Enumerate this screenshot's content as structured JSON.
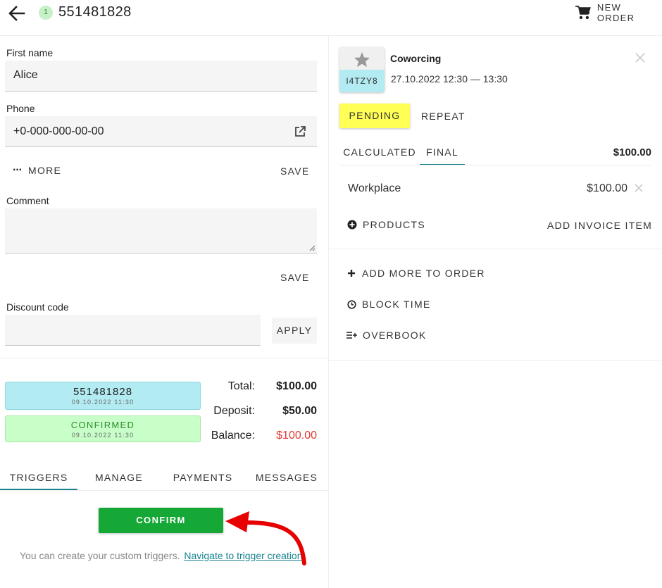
{
  "header": {
    "back_icon": "arrow-left-icon",
    "badge_count": "1",
    "order_id": "551481828",
    "new_order_label": "NEW ORDER",
    "cart_icon": "cart-icon"
  },
  "form": {
    "first_name_label": "First name",
    "first_name_value": "Alice",
    "phone_label": "Phone",
    "phone_value": "+0-000-000-00-00",
    "more_label": "MORE",
    "save_label": "SAVE",
    "comment_label": "Comment",
    "comment_value": "",
    "comment_save_label": "SAVE",
    "discount_label": "Discount code",
    "discount_value": "",
    "apply_label": "APPLY"
  },
  "status_cards": {
    "order_number": "551481828",
    "order_date": "09.10.2022 11:30",
    "confirmed_label": "CONFIRMED",
    "confirmed_date": "09.10.2022 11:30"
  },
  "totals": {
    "total_label": "Total:",
    "total_value": "$100.00",
    "deposit_label": "Deposit:",
    "deposit_value": "$50.00",
    "balance_label": "Balance:",
    "balance_value": "$100.00"
  },
  "tabs": [
    {
      "label": "TRIGGERS",
      "active": true
    },
    {
      "label": "MANAGE",
      "active": false
    },
    {
      "label": "PAYMENTS",
      "active": false
    },
    {
      "label": "MESSAGES",
      "active": false
    }
  ],
  "triggers": {
    "confirm_label": "CONFIRM",
    "hint_text": "You can create your custom triggers.",
    "link_text": "Navigate to trigger creation"
  },
  "booking": {
    "code": "I4TZY8",
    "resource_name": "Coworcing",
    "datetime": "27.10.2022 12:30 — 13:30",
    "pending_label": "PENDING",
    "repeat_label": "REPEAT",
    "price_tabs": [
      {
        "label": "CALCULATED",
        "active": false
      },
      {
        "label": "FINAL",
        "active": true
      }
    ],
    "price_total": "$100.00",
    "item_name": "Workplace",
    "item_price": "$100.00",
    "products_label": "PRODUCTS",
    "add_invoice_label": "ADD INVOICE ITEM"
  },
  "actions": {
    "add_more_label": "ADD MORE TO ORDER",
    "block_time_label": "BLOCK TIME",
    "overbook_label": "OVERBOOK"
  },
  "colors": {
    "green_accent": "#16a837",
    "cyan_card": "#b3ebf2",
    "confirmed_card": "#c8ffc8",
    "pending_yellow": "#ffff55",
    "balance_red": "#e53935",
    "tab_teal": "#18848f"
  }
}
